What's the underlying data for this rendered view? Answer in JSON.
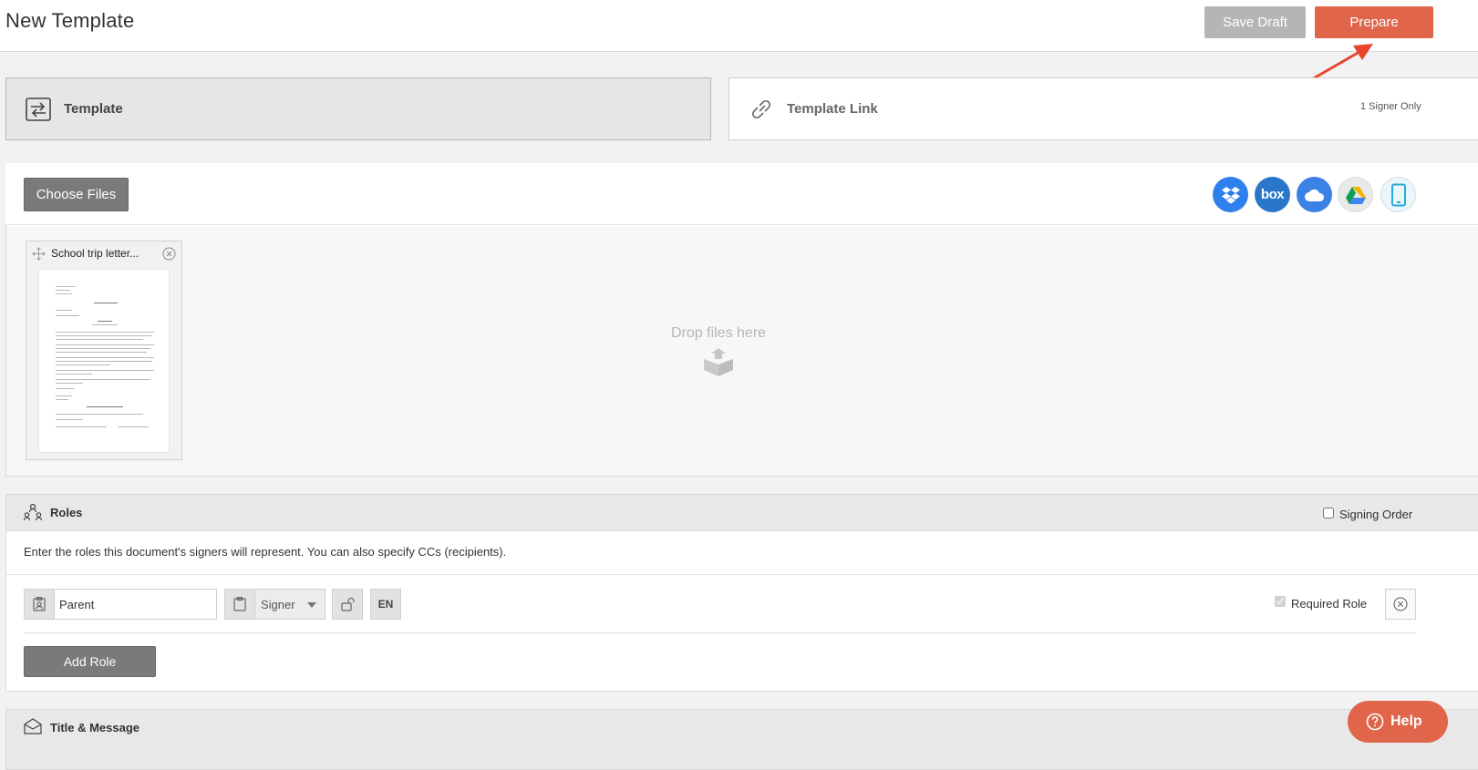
{
  "header": {
    "title": "New Template",
    "save_draft_label": "Save Draft",
    "prepare_label": "Prepare"
  },
  "modes": {
    "template_label": "Template",
    "template_link_label": "Template Link",
    "template_link_note": "1 Signer Only"
  },
  "files": {
    "choose_files_label": "Choose Files",
    "cloud_sources": [
      "dropbox-icon",
      "box-icon",
      "onedrive-icon",
      "google-drive-icon",
      "mobile-device-icon"
    ],
    "box_logo_text": "box",
    "uploaded": [
      {
        "name": "School trip letter..."
      }
    ],
    "drop_text": "Drop files here"
  },
  "roles": {
    "title": "Roles",
    "signing_order_label": "Signing Order",
    "signing_order_checked": false,
    "description": "Enter the roles this document's signers will represent. You can also specify CCs (recipients).",
    "items": [
      {
        "name": "Parent",
        "type": "Signer",
        "language": "EN",
        "required_label": "Required Role",
        "required": true
      }
    ],
    "add_role_label": "Add Role"
  },
  "title_message": {
    "label": "Title & Message"
  },
  "help": {
    "label": "Help"
  },
  "colors": {
    "accent": "#e0654b",
    "button_gray": "#7a7a7a",
    "disabled_gray": "#b5b5b5"
  }
}
